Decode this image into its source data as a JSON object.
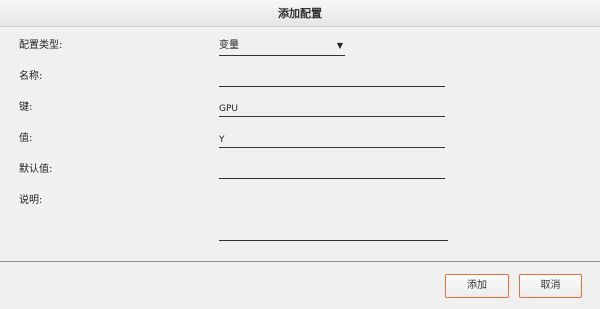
{
  "dialog": {
    "title": "添加配置"
  },
  "form": {
    "type_label": "配置类型:",
    "type_value": "变量",
    "type_arrow": "▼",
    "name_label": "名称:",
    "name_value": "",
    "key_label": "键:",
    "key_value": "GPU",
    "value_label": "值:",
    "value_value": "Y",
    "default_label": "默认值:",
    "default_value": "",
    "desc_label": "说明:",
    "desc_value": ""
  },
  "buttons": {
    "add_label": "添加",
    "cancel_label": "取消"
  }
}
